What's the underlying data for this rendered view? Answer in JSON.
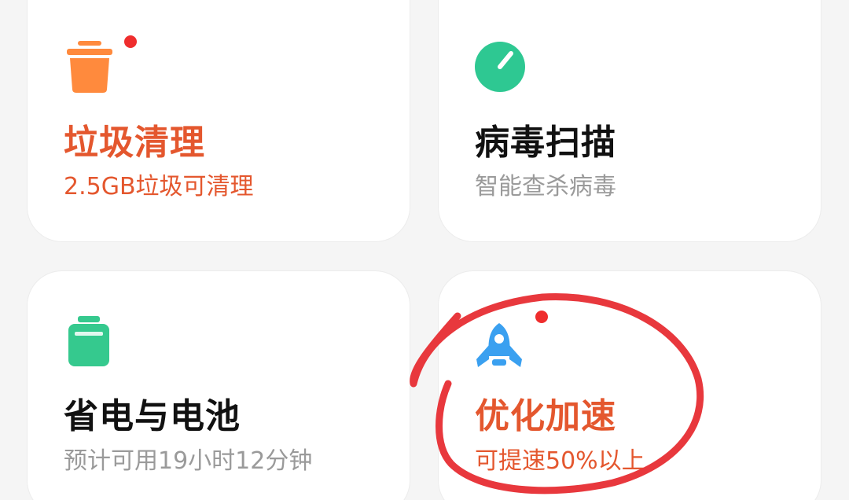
{
  "cards": [
    {
      "title": "垃圾清理",
      "subtitle": "2.5GB垃圾可清理",
      "icon": "trash-can-icon",
      "title_color": "#e4572e",
      "subtitle_color": "#e4572e",
      "icon_color": "#ff8a3d",
      "has_notification_dot": true
    },
    {
      "title": "病毒扫描",
      "subtitle": "智能查杀病毒",
      "icon": "scan-gauge-icon",
      "title_color": "#111111",
      "subtitle_color": "#9a9a9a",
      "icon_color": "#2ec892",
      "has_notification_dot": false
    },
    {
      "title": "省电与电池",
      "subtitle": "预计可用19小时12分钟",
      "icon": "battery-icon",
      "title_color": "#111111",
      "subtitle_color": "#9a9a9a",
      "icon_color": "#35c98e",
      "has_notification_dot": false
    },
    {
      "title": "优化加速",
      "subtitle": "可提速50%以上",
      "icon": "rocket-icon",
      "title_color": "#e4572e",
      "subtitle_color": "#e4572e",
      "icon_color": "#3aa0f0",
      "has_notification_dot": true
    }
  ],
  "colors": {
    "notification_dot": "#ef2d2d",
    "hand_drawn_circle": "#e8383d",
    "background": "#f5f5f5",
    "card": "#ffffff"
  }
}
